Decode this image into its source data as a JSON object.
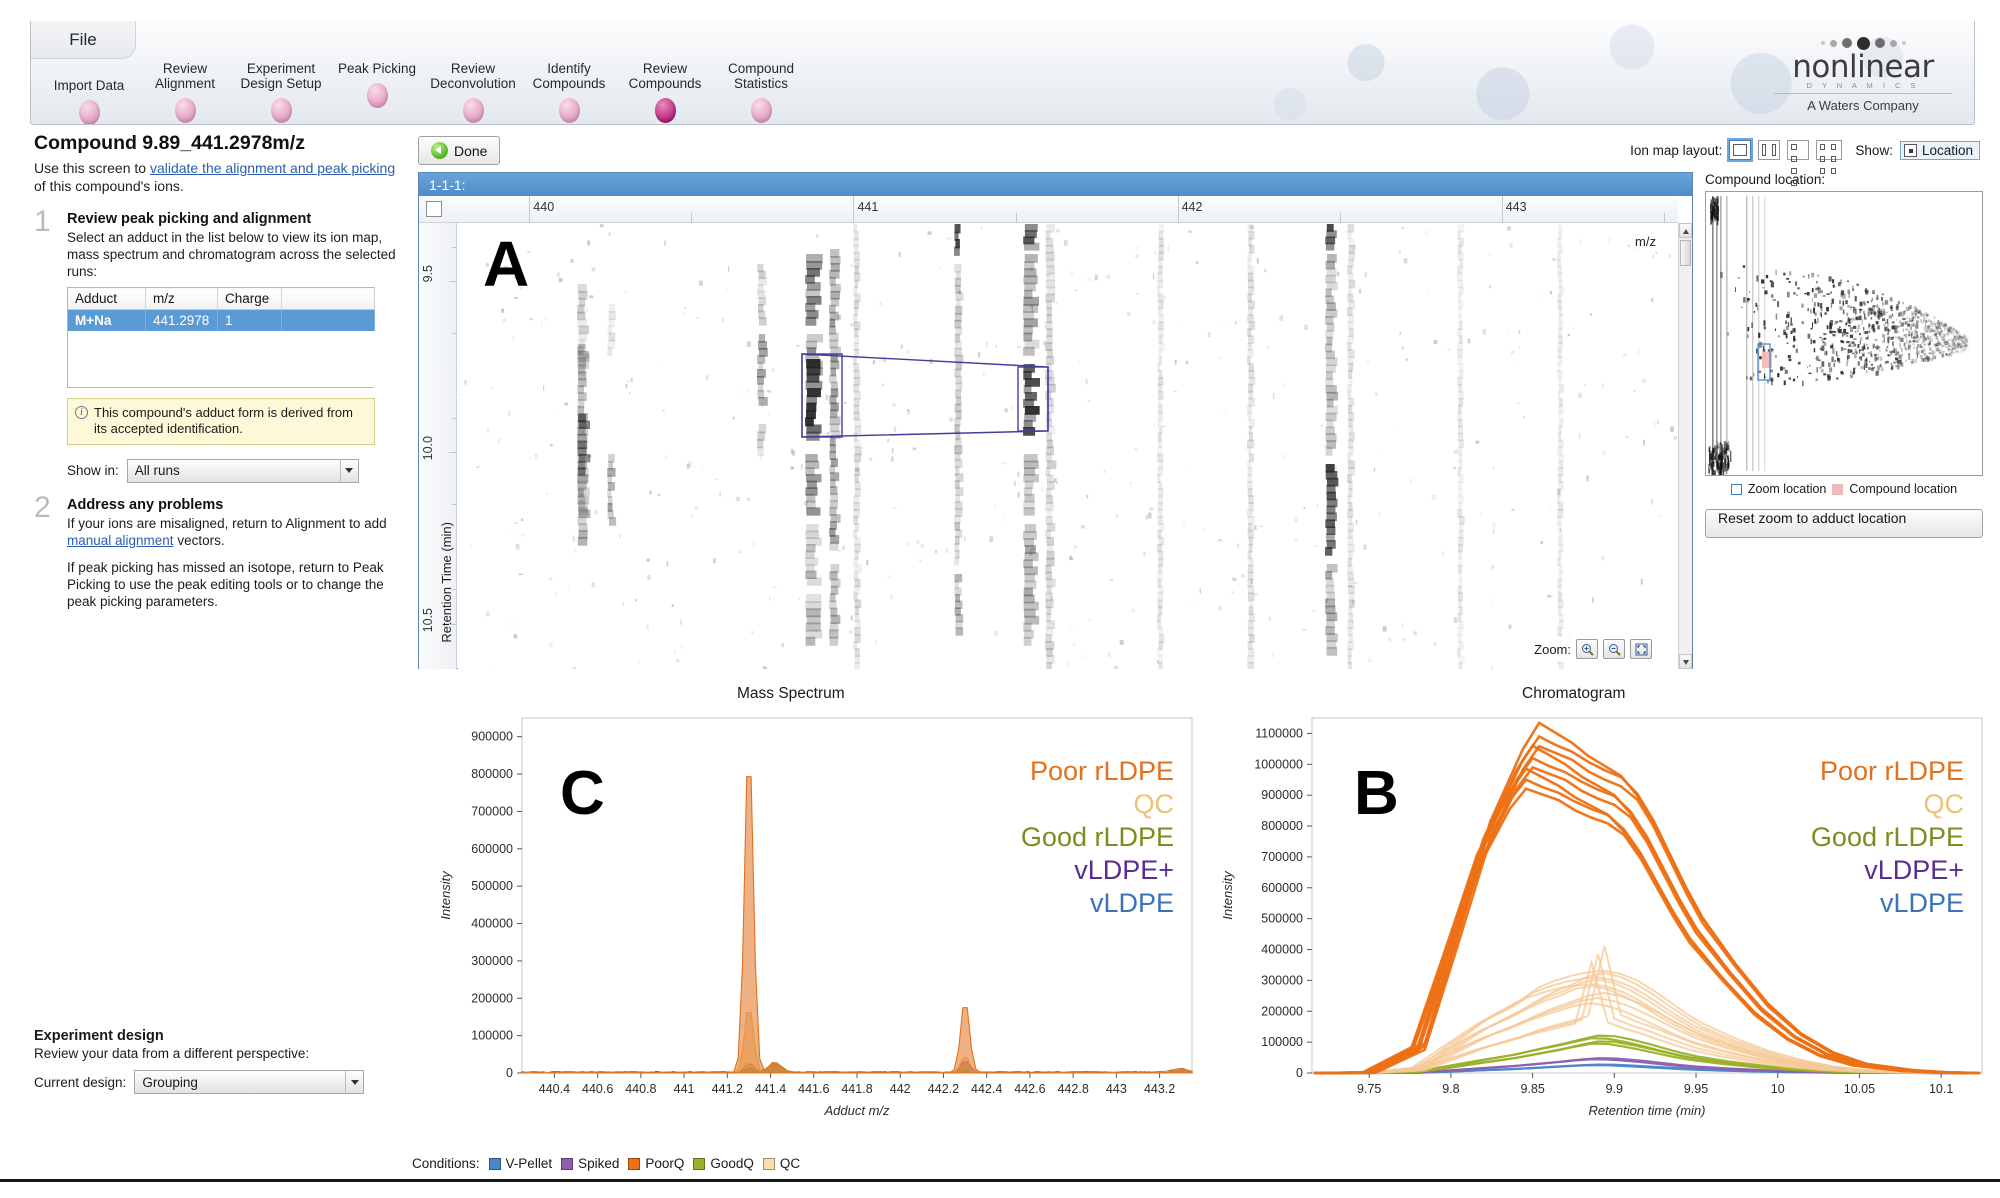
{
  "ribbon": {
    "file_tab": "File",
    "steps": [
      {
        "label": "Import Data",
        "active": false
      },
      {
        "label": "Review\nAlignment",
        "active": false
      },
      {
        "label": "Experiment\nDesign Setup",
        "active": false
      },
      {
        "label": "Peak Picking",
        "active": false
      },
      {
        "label": "Review\nDeconvolution",
        "active": false
      },
      {
        "label": "Identify\nCompounds",
        "active": false
      },
      {
        "label": "Review\nCompounds",
        "active": true
      },
      {
        "label": "Compound\nStatistics",
        "active": false
      }
    ]
  },
  "logo": {
    "word": "nonlinear",
    "sub": "D Y N A M I C S",
    "tagline": "A Waters Company"
  },
  "sidebar": {
    "compound_title": "Compound 9.89_441.2978m/z",
    "intro_prefix": "Use this screen to ",
    "intro_link": "validate the alignment and peak picking",
    "intro_suffix": " of this compound's ions.",
    "step1": {
      "number": "1",
      "heading": "Review peak picking and alignment",
      "body": "Select an adduct in the list below to view its ion map, mass spectrum and chromatogram across the selected runs:"
    },
    "adduct_table": {
      "headers": [
        "Adduct",
        "m/z",
        "Charge",
        ""
      ],
      "rows": [
        [
          "M+Na",
          "441.2978",
          "1",
          ""
        ]
      ]
    },
    "info_note": "This compound's adduct form is derived from its accepted identification.",
    "show_in_label": "Show in:",
    "show_in_value": "All runs",
    "step2": {
      "number": "2",
      "heading": "Address any problems",
      "body_a_prefix": "If your ions are misaligned, return to Alignment to add ",
      "body_a_link": "manual alignment",
      "body_a_suffix": " vectors.",
      "body_b": "If peak picking has missed an isotope, return to Peak Picking to use the peak editing tools or to change the peak picking parameters."
    },
    "experiment_design": {
      "heading": "Experiment design",
      "body": "Review your data from a different perspective:",
      "current_design_label": "Current design:",
      "current_design_value": "Grouping"
    }
  },
  "toolbar": {
    "done_label": "Done",
    "ion_map_layout_label": "Ion map layout:",
    "layout_options": [
      "1x1",
      "1x2",
      "2x2",
      "2x3"
    ],
    "layout_selected_index": 0,
    "show_label": "Show:",
    "show_value": "Location"
  },
  "ion_map": {
    "run_label": "1-1-1:",
    "x_axis_title": "m/z",
    "x_ticks": [
      "440",
      "441",
      "442",
      "443"
    ],
    "y_axis_title": "Retention Time (min)",
    "y_ticks": [
      "9.5",
      "10.0",
      "10.5"
    ],
    "panel_letter": "A",
    "zoom_label": "Zoom:",
    "zoom_buttons": [
      "zoom-in",
      "zoom-out",
      "zoom-fit"
    ]
  },
  "location_panel": {
    "title": "Compound location:",
    "legend": [
      {
        "label": "Zoom location",
        "color": "#ffffff",
        "border": "#3a7fc2"
      },
      {
        "label": "Compound location",
        "color": "#f0b9b9",
        "border": "#f0b9b9"
      }
    ],
    "reset_button": "Reset zoom to adduct location"
  },
  "mass_spectrum": {
    "title": "Mass Spectrum",
    "panel_letter": "C"
  },
  "chromatogram": {
    "title": "Chromatogram",
    "panel_letter": "B"
  },
  "series_legend": [
    {
      "label": "Poor rLDPE",
      "color": "#e2711d"
    },
    {
      "label": "QC",
      "color": "#f0c07a"
    },
    {
      "label": "Good rLDPE",
      "color": "#7d8c1f"
    },
    {
      "label": "vLDPE+",
      "color": "#5b2d8e"
    },
    {
      "label": "vLDPE",
      "color": "#3b73b9"
    }
  ],
  "conditions": {
    "label": "Conditions:",
    "items": [
      {
        "label": "V-Pellet",
        "color": "#4a87c8"
      },
      {
        "label": "Spiked",
        "color": "#8e5fb0"
      },
      {
        "label": "PoorQ",
        "color": "#ed7014"
      },
      {
        "label": "GoodQ",
        "color": "#9bb02a"
      },
      {
        "label": "QC",
        "color": "#fbdcab"
      }
    ]
  },
  "chart_data": [
    {
      "type": "line",
      "title": "Mass Spectrum",
      "xlabel": "Adduct m/z",
      "ylabel": "Intensity",
      "xlim": [
        440.25,
        443.35
      ],
      "ylim": [
        0,
        950000
      ],
      "xticks": [
        440.4,
        440.6,
        440.8,
        441,
        441.2,
        441.4,
        441.6,
        441.8,
        442,
        442.2,
        442.4,
        442.6,
        442.8,
        443,
        443.2
      ],
      "xticklabels": [
        "440.4",
        "440.6",
        "440.8",
        "441",
        "441.2",
        "441.4",
        "441.6",
        "441.8",
        "442",
        "442.2",
        "442.4",
        "442.6",
        "442.8",
        "443",
        "443.2"
      ],
      "yticks": [
        0,
        100000,
        200000,
        300000,
        400000,
        500000,
        600000,
        700000,
        800000,
        900000
      ],
      "yticklabels": [
        "0",
        "100000",
        "200000",
        "300000",
        "400000",
        "500000",
        "600000",
        "700000",
        "800000",
        "900000"
      ],
      "grid": false,
      "legend_position": "upper-right",
      "series": [
        {
          "name": "Poor rLDPE",
          "color": "#e2711d",
          "peaks": [
            {
              "mz": 441.3,
              "intensity": 900000
            },
            {
              "mz": 442.3,
              "intensity": 197000
            }
          ]
        },
        {
          "name": "QC",
          "color": "#f0c07a",
          "peaks": [
            {
              "mz": 441.3,
              "intensity": 180000
            },
            {
              "mz": 442.3,
              "intensity": 42000
            }
          ]
        },
        {
          "name": "Good rLDPE",
          "color": "#7d8c1f",
          "peaks": [
            {
              "mz": 441.3,
              "intensity": 26000
            },
            {
              "mz": 442.3,
              "intensity": 7000
            }
          ]
        },
        {
          "name": "vLDPE+",
          "color": "#5b2d8e",
          "peaks": [
            {
              "mz": 441.3,
              "intensity": 12000
            },
            {
              "mz": 442.3,
              "intensity": 30000
            }
          ]
        },
        {
          "name": "vLDPE",
          "color": "#3b73b9",
          "peaks": [
            {
              "mz": 441.3,
              "intensity": 6000
            },
            {
              "mz": 442.3,
              "intensity": 4000
            }
          ]
        }
      ]
    },
    {
      "type": "line",
      "title": "Chromatogram",
      "xlabel": "Retention time (min)",
      "ylabel": "Intensity",
      "xlim": [
        9.715,
        10.125
      ],
      "ylim": [
        0,
        1150000
      ],
      "xticks": [
        9.75,
        9.8,
        9.85,
        9.9,
        9.95,
        10,
        10.05,
        10.1
      ],
      "xticklabels": [
        "9.75",
        "9.8",
        "9.85",
        "9.9",
        "9.95",
        "10",
        "10.05",
        "10.1"
      ],
      "yticks": [
        0,
        100000,
        200000,
        300000,
        400000,
        500000,
        600000,
        700000,
        800000,
        900000,
        1000000,
        1100000
      ],
      "yticklabels": [
        "0",
        "100000",
        "200000",
        "300000",
        "400000",
        "500000",
        "600000",
        "700000",
        "800000",
        "900000",
        "1000000",
        "1100000"
      ],
      "grid": false,
      "legend_position": "upper-right",
      "x": [
        9.72,
        9.75,
        9.78,
        9.8,
        9.82,
        9.84,
        9.85,
        9.86,
        9.87,
        9.88,
        9.89,
        9.9,
        9.91,
        9.92,
        9.93,
        9.94,
        9.95,
        9.97,
        9.99,
        10.01,
        10.03,
        10.05,
        10.08,
        10.1,
        10.12
      ],
      "series": [
        {
          "name": "Poor rLDPE",
          "color": "#ed7014",
          "values": [
            0,
            2000,
            90000,
            420000,
            760000,
            980000,
            1060000,
            1030000,
            1000000,
            960000,
            930000,
            900000,
            840000,
            760000,
            660000,
            560000,
            470000,
            330000,
            210000,
            120000,
            62000,
            28000,
            8000,
            2000,
            0
          ]
        },
        {
          "name": "Poor rLDPE b",
          "color": "#ed7014",
          "values": [
            0,
            1000,
            70000,
            380000,
            700000,
            910000,
            980000,
            960000,
            940000,
            905000,
            880000,
            860000,
            820000,
            740000,
            640000,
            540000,
            450000,
            320000,
            200000,
            115000,
            58000,
            26000,
            7000,
            1500,
            0
          ]
        },
        {
          "name": "Poor rLDPE c",
          "color": "#ed7014",
          "values": [
            0,
            1500,
            80000,
            400000,
            730000,
            930000,
            1000000,
            975000,
            955000,
            925000,
            900000,
            880000,
            830000,
            750000,
            650000,
            550000,
            460000,
            325000,
            205000,
            118000,
            60000,
            27000,
            7500,
            1800,
            0
          ]
        },
        {
          "name": "QC",
          "color": "#f6c894",
          "values": [
            0,
            500,
            18000,
            95000,
            170000,
            225000,
            260000,
            280000,
            295000,
            305000,
            310000,
            300000,
            280000,
            250000,
            215000,
            180000,
            150000,
            105000,
            68000,
            40000,
            20000,
            9000,
            2500,
            600,
            0
          ]
        },
        {
          "name": "QC b",
          "color": "#f6c894",
          "values": [
            0,
            400,
            14000,
            78000,
            140000,
            190000,
            220000,
            245000,
            265000,
            290000,
            300000,
            288000,
            265000,
            235000,
            200000,
            168000,
            138000,
            96000,
            62000,
            36000,
            18000,
            8000,
            2200,
            500,
            0
          ]
        },
        {
          "name": "QC c",
          "color": "#f6c894",
          "values": [
            0,
            300,
            11000,
            62000,
            112000,
            152000,
            175000,
            195000,
            212000,
            230000,
            238000,
            228000,
            210000,
            186000,
            160000,
            134000,
            110000,
            77000,
            50000,
            29000,
            15000,
            6500,
            1800,
            400,
            0
          ]
        },
        {
          "name": "QC d",
          "color": "#f6c894",
          "values": [
            0,
            200,
            8000,
            45000,
            82000,
            112000,
            130000,
            145000,
            158000,
            172000,
            385000,
            176000,
            155000,
            138000,
            118000,
            99000,
            81000,
            57000,
            37000,
            21000,
            11000,
            4800,
            1300,
            300,
            0
          ]
        },
        {
          "name": "Good rLDPE",
          "color": "#9bb02a",
          "values": [
            0,
            100,
            4000,
            22000,
            42000,
            60000,
            72000,
            84000,
            95000,
            108000,
            120000,
            118000,
            108000,
            95000,
            80000,
            66000,
            54000,
            37000,
            24000,
            14000,
            7000,
            3000,
            900,
            200,
            0
          ]
        },
        {
          "name": "Good rLDPE b",
          "color": "#9bb02a",
          "values": [
            0,
            80,
            3000,
            17000,
            33000,
            48000,
            58000,
            68000,
            78000,
            90000,
            100000,
            99000,
            90000,
            79000,
            67000,
            55000,
            45000,
            31000,
            20000,
            11500,
            5800,
            2500,
            700,
            150,
            0
          ]
        },
        {
          "name": "vLDPE+",
          "color": "#8e5fb0",
          "values": [
            0,
            40,
            1500,
            8000,
            16000,
            23000,
            28000,
            33000,
            38000,
            44000,
            48000,
            47000,
            43000,
            38000,
            32000,
            26000,
            21000,
            14500,
            9500,
            5500,
            2800,
            1200,
            350,
            80,
            0
          ]
        },
        {
          "name": "vLDPE",
          "color": "#4a87c8",
          "values": [
            0,
            20,
            800,
            4500,
            9000,
            13000,
            16000,
            19000,
            22000,
            25000,
            27000,
            26500,
            24000,
            21000,
            18000,
            15000,
            12000,
            8200,
            5300,
            3100,
            1600,
            700,
            200,
            40,
            0
          ]
        }
      ]
    }
  ]
}
